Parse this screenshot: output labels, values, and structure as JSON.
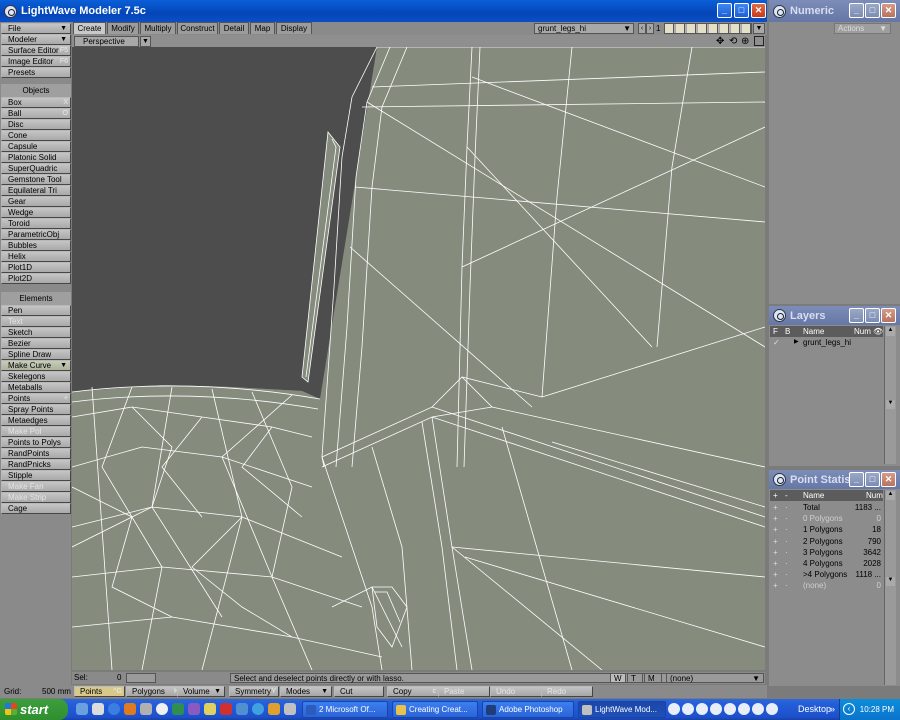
{
  "main_window": {
    "title": "LightWave Modeler 7.5c",
    "buttons": {
      "minimize": "_",
      "maximize": "□",
      "close": "✕"
    }
  },
  "tabs": [
    {
      "label": "Create",
      "active": true
    },
    {
      "label": "Modify",
      "active": false
    },
    {
      "label": "Multiply",
      "active": false
    },
    {
      "label": "Construct",
      "active": false
    },
    {
      "label": "Detail",
      "active": false
    },
    {
      "label": "Map",
      "active": false
    },
    {
      "label": "Display",
      "active": false
    }
  ],
  "top_right": {
    "object_name": "grunt_legs_hi",
    "layer_number": "1"
  },
  "viewport": {
    "view_mode": "Perspective",
    "background_color": "#4d4d4d",
    "mesh_fill": "#858c7e",
    "wire_color": "#ffffff"
  },
  "toolbar": {
    "menu_items": [
      {
        "label": "File",
        "arrow": true
      },
      {
        "label": "Modeler",
        "arrow": true
      },
      {
        "label": "Surface Editor",
        "shortcut": "F5"
      },
      {
        "label": "Image Editor",
        "shortcut": "F6"
      },
      {
        "label": "Presets"
      }
    ],
    "objects_header": "Objects",
    "objects": [
      {
        "label": "Box",
        "shortcut": "X"
      },
      {
        "label": "Ball",
        "shortcut": "O"
      },
      {
        "label": "Disc"
      },
      {
        "label": "Cone"
      },
      {
        "label": "Capsule"
      },
      {
        "label": "Platonic Solid"
      },
      {
        "label": "SuperQuadric"
      },
      {
        "label": "Gemstone Tool"
      },
      {
        "label": "Equilateral Tri"
      },
      {
        "label": "Gear"
      },
      {
        "label": "Wedge"
      },
      {
        "label": "Toroid"
      },
      {
        "label": "ParametricObj"
      },
      {
        "label": "Bubbles"
      },
      {
        "label": "Helix"
      },
      {
        "label": "Plot1D"
      },
      {
        "label": "Plot2D"
      }
    ],
    "elements_header": "Elements",
    "elements": [
      {
        "label": "Pen"
      },
      {
        "label": "Text",
        "dim": true
      },
      {
        "label": "Sketch"
      },
      {
        "label": "Bezier"
      },
      {
        "label": "Spline Draw"
      },
      {
        "label": "Make Curve",
        "arrow": true,
        "hl": true
      },
      {
        "label": "Skelegons"
      },
      {
        "label": "Metaballs"
      },
      {
        "label": "Points",
        "shortcut": "+"
      },
      {
        "label": "Spray Points"
      },
      {
        "label": "Metaedges"
      },
      {
        "label": "Make Pol",
        "dim": true
      },
      {
        "label": "Points to Polys"
      },
      {
        "label": "RandPoints"
      },
      {
        "label": "RandPnicks"
      },
      {
        "label": "Stipple"
      },
      {
        "label": "Make Fan",
        "dim": true
      },
      {
        "label": "Make Strip",
        "dim": true
      },
      {
        "label": "Cage"
      }
    ]
  },
  "status": {
    "sel_label": "Sel:",
    "sel_value": "0",
    "message": "Select and deselect points directly or with lasso.",
    "grid_label": "Grid:",
    "grid_value": "500 mm",
    "w": "W",
    "t": "T",
    "m": "M",
    "surface": "(none)"
  },
  "bottom_buttons": [
    {
      "label": "Points",
      "shortcut": "^G",
      "active": true
    },
    {
      "label": "Polygons",
      "shortcut": "H"
    },
    {
      "label": "Volume",
      "arrow": true
    },
    {
      "label": "Symmetry",
      "shortcut": "Y"
    },
    {
      "label": "Modes",
      "arrow": true
    },
    {
      "label": "Cut"
    },
    {
      "label": "Copy",
      "shortcut": "c"
    },
    {
      "label": "Paste",
      "dim": true
    },
    {
      "label": "Undo",
      "dim": true
    },
    {
      "label": "Redo",
      "dim": true
    }
  ],
  "numeric_panel": {
    "title": "Numeric",
    "actions_label": "Actions"
  },
  "layers_panel": {
    "title": "Layers",
    "col_f": "F",
    "col_b": "B",
    "col_name": "Name",
    "col_num": "Num",
    "row_name": "grunt_legs_hi"
  },
  "point_stats_panel": {
    "title": "Point Statis...",
    "col_name": "Name",
    "col_num": "Num",
    "rows": [
      {
        "name": "Total",
        "num": "1183 ...",
        "dim": false
      },
      {
        "name": "0 Polygons",
        "num": "0",
        "dim": true
      },
      {
        "name": "1 Polygons",
        "num": "18",
        "dim": false
      },
      {
        "name": "2 Polygons",
        "num": "790",
        "dim": false
      },
      {
        "name": "3 Polygons",
        "num": "3642",
        "dim": false
      },
      {
        "name": "4 Polygons",
        "num": "2028",
        "dim": false
      },
      {
        "name": ">4 Polygons",
        "num": "1118 ...",
        "dim": false
      },
      {
        "name": "(none)",
        "num": "0",
        "dim": true
      }
    ]
  },
  "taskbar": {
    "start_label": "start",
    "tasks": [
      {
        "label": "2 Microsoft Of...",
        "color": "#2b5cbd"
      },
      {
        "label": "Creating Creat...",
        "color": "#e8c24a"
      },
      {
        "label": "Adobe Photoshop",
        "color": "#1f3d7a"
      },
      {
        "label": "LightWave Mod...",
        "color": "#bfbfbf",
        "active": true
      }
    ],
    "desktop_label": "Desktop",
    "clock": "10:28 PM"
  }
}
